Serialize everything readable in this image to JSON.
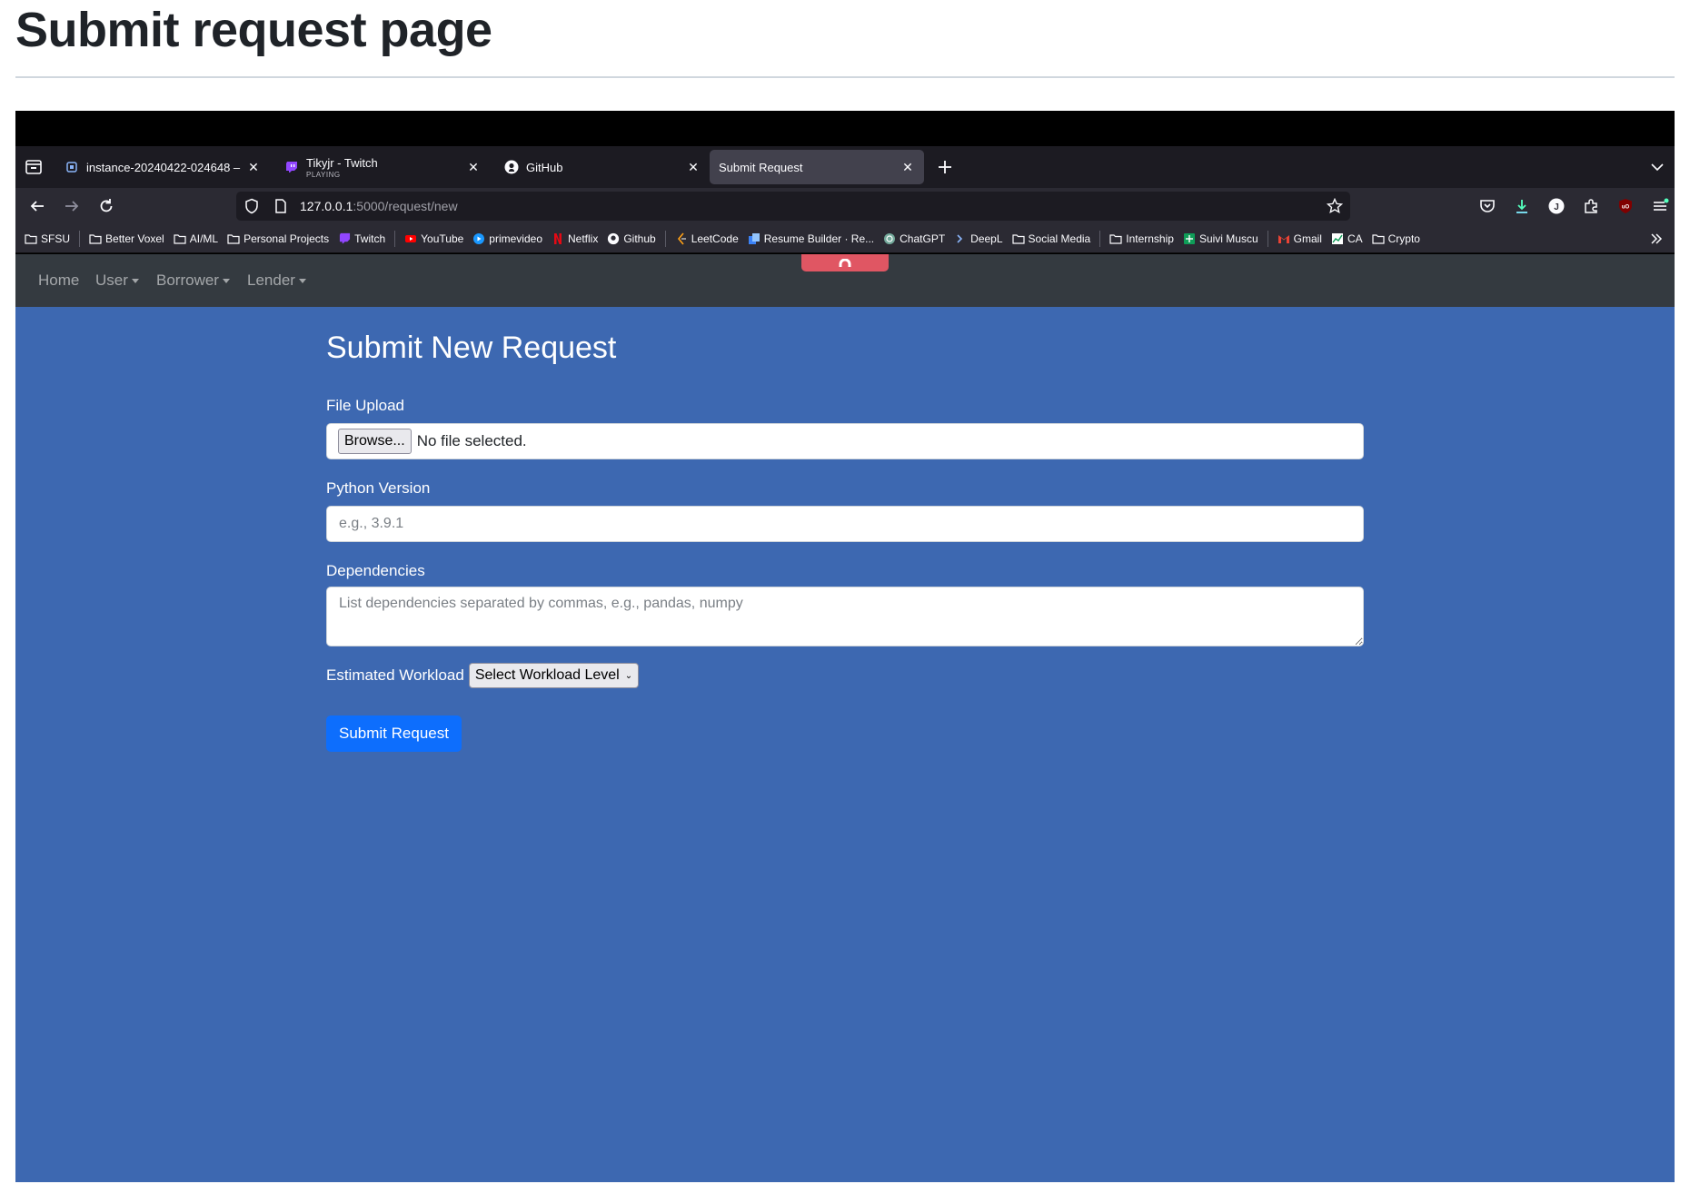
{
  "document": {
    "title": "Submit request page"
  },
  "browser": {
    "tabs": [
      {
        "title": "instance-20240422-024648 –",
        "icon": "chip-icon",
        "active": false
      },
      {
        "title": "Tikyjr - Twitch",
        "subtitle": "PLAYING",
        "icon": "twitch-icon",
        "active": false
      },
      {
        "title": "GitHub",
        "icon": "github-icon",
        "active": false
      },
      {
        "title": "Submit Request",
        "icon": "none",
        "active": true
      }
    ],
    "url_host": "127.0.0.1",
    "url_rest": ":5000/request/new",
    "bookmarks": [
      {
        "label": "SFSU",
        "icon": "folder-icon"
      },
      {
        "label": "Better Voxel",
        "icon": "folder-icon"
      },
      {
        "label": "AI/ML",
        "icon": "folder-icon"
      },
      {
        "label": "Personal Projects",
        "icon": "folder-icon"
      },
      {
        "label": "Twitch",
        "icon": "twitch-icon"
      },
      {
        "label": "YouTube",
        "icon": "youtube-icon"
      },
      {
        "label": "primevideo",
        "icon": "primevideo-icon"
      },
      {
        "label": "Netflix",
        "icon": "netflix-icon"
      },
      {
        "label": "Github",
        "icon": "github-icon"
      },
      {
        "label": "LeetCode",
        "icon": "leetcode-icon"
      },
      {
        "label": "Resume Builder · Re...",
        "icon": "resume-icon"
      },
      {
        "label": "ChatGPT",
        "icon": "chatgpt-icon"
      },
      {
        "label": "DeepL",
        "icon": "deepl-icon"
      },
      {
        "label": "Social Media",
        "icon": "folder-icon"
      },
      {
        "label": "Internship",
        "icon": "folder-icon"
      },
      {
        "label": "Suivi Muscu",
        "icon": "sheets-icon"
      },
      {
        "label": "Gmail",
        "icon": "gmail-icon"
      },
      {
        "label": "CA",
        "icon": "chart-icon"
      },
      {
        "label": "Crypto",
        "icon": "folder-icon"
      }
    ]
  },
  "site_nav": {
    "home": "Home",
    "user": "User",
    "borrower": "Borrower",
    "lender": "Lender"
  },
  "form": {
    "title": "Submit New Request",
    "file_label": "File Upload",
    "browse_label": "Browse...",
    "file_status": "No file selected.",
    "python_label": "Python Version",
    "python_placeholder": "e.g., 3.9.1",
    "deps_label": "Dependencies",
    "deps_placeholder": "List dependencies separated by commas, e.g., pandas, numpy",
    "workload_label": "Estimated Workload",
    "workload_selected": "Select Workload Level",
    "submit_label": "Submit Request"
  },
  "colors": {
    "page_bg": "#3d68b1",
    "site_nav_bg": "#343a40",
    "primary_button": "#0d6efd",
    "pull_tab": "#e05663",
    "browser_tabbar": "#1c1b22",
    "browser_toolbar": "#2b2a33"
  }
}
